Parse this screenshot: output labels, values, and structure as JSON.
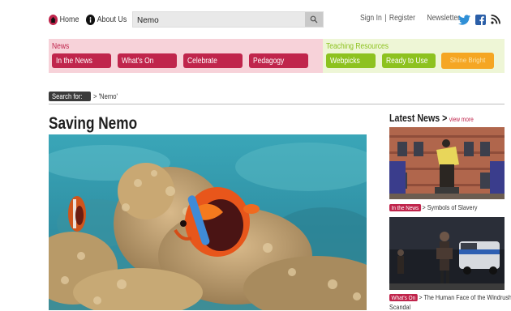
{
  "header": {
    "home_label": "Home",
    "about_label": "About Us",
    "search": {
      "value": "Nemo",
      "icon": "search-icon"
    },
    "sign_in_label": "Sign In",
    "separator": "|",
    "register_label": "Register",
    "newsletter_label": "Newsletter",
    "social": [
      "twitter-icon",
      "facebook-icon",
      "rss-icon"
    ]
  },
  "categories": {
    "news_label": "News",
    "news_items": [
      "In the News",
      "What's On",
      "Celebrate",
      "Pedagogy"
    ],
    "teaching_label": "Teaching Resources",
    "teaching_items": [
      "Webpicks",
      "Ready to Use",
      "Shine Bright"
    ],
    "colors": {
      "news": "#c0254c",
      "news_bg": "#f7d2d9",
      "teaching": "#8dc21f",
      "teaching_bg": "#eef6d6",
      "highlight": "#f5a623"
    }
  },
  "search_context": {
    "badge": "Search for:",
    "term": "> 'Nemo'"
  },
  "article": {
    "title": "Saving Nemo"
  },
  "sidebar": {
    "title": "Latest News >",
    "view_more": "view more",
    "items": [
      {
        "tag": "In the News",
        "text": "> Symbols of Slavery"
      },
      {
        "tag": "What's On",
        "text": "> The Human Face of the Windrush"
      },
      {
        "tag": "",
        "text": "Scandal"
      }
    ]
  }
}
